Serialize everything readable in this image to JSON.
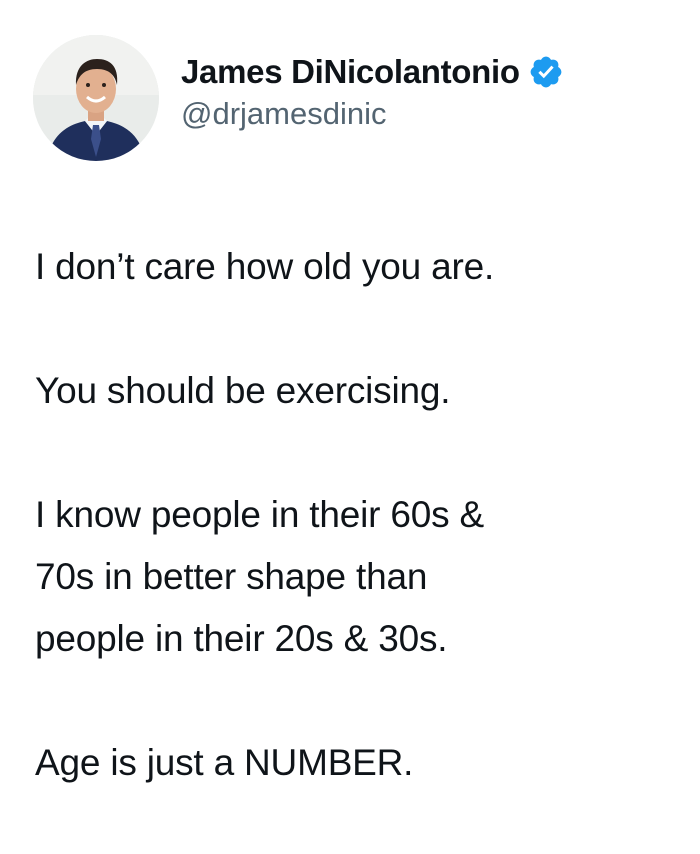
{
  "author": {
    "name": "James DiNicolantonio",
    "handle": "@drjamesdinic",
    "verified_icon": "verified-badge-icon",
    "verified_color": "#1d9bf0",
    "avatar_icon": "profile-photo"
  },
  "tweet": {
    "paragraphs": [
      [
        "I don’t care how old you are."
      ],
      [
        "You should be exercising."
      ],
      [
        "I know people in their 60s &",
        "70s in better shape than",
        "people in their 20s & 30s."
      ],
      [
        "Age is just a NUMBER."
      ]
    ]
  },
  "colors": {
    "text": "#0f1419",
    "secondary_text": "#536471",
    "background": "#ffffff"
  }
}
